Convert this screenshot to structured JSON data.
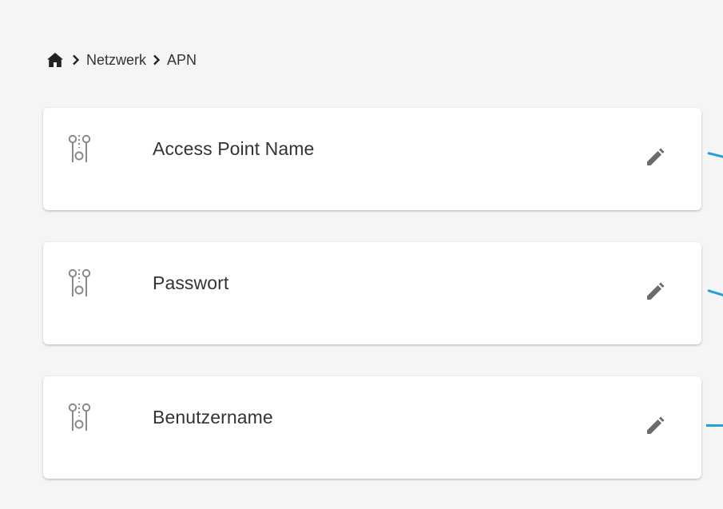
{
  "breadcrumb": {
    "home_icon": "home-icon",
    "separator_icon": "chevron-right-icon",
    "items": [
      {
        "label": "Netzwerk"
      },
      {
        "label": "APN"
      }
    ]
  },
  "settings": [
    {
      "label": "Access Point Name",
      "icon": "settings-slider-icon",
      "action_icon": "pencil-icon"
    },
    {
      "label": "Passwort",
      "icon": "settings-slider-icon",
      "action_icon": "pencil-icon"
    },
    {
      "label": "Benutzername",
      "icon": "settings-slider-icon",
      "action_icon": "pencil-icon"
    }
  ],
  "colors": {
    "background": "#f5f5f5",
    "card": "#ffffff",
    "text": "#333333",
    "icon": "#8a8a8a",
    "connector": "#1ea0d9"
  }
}
